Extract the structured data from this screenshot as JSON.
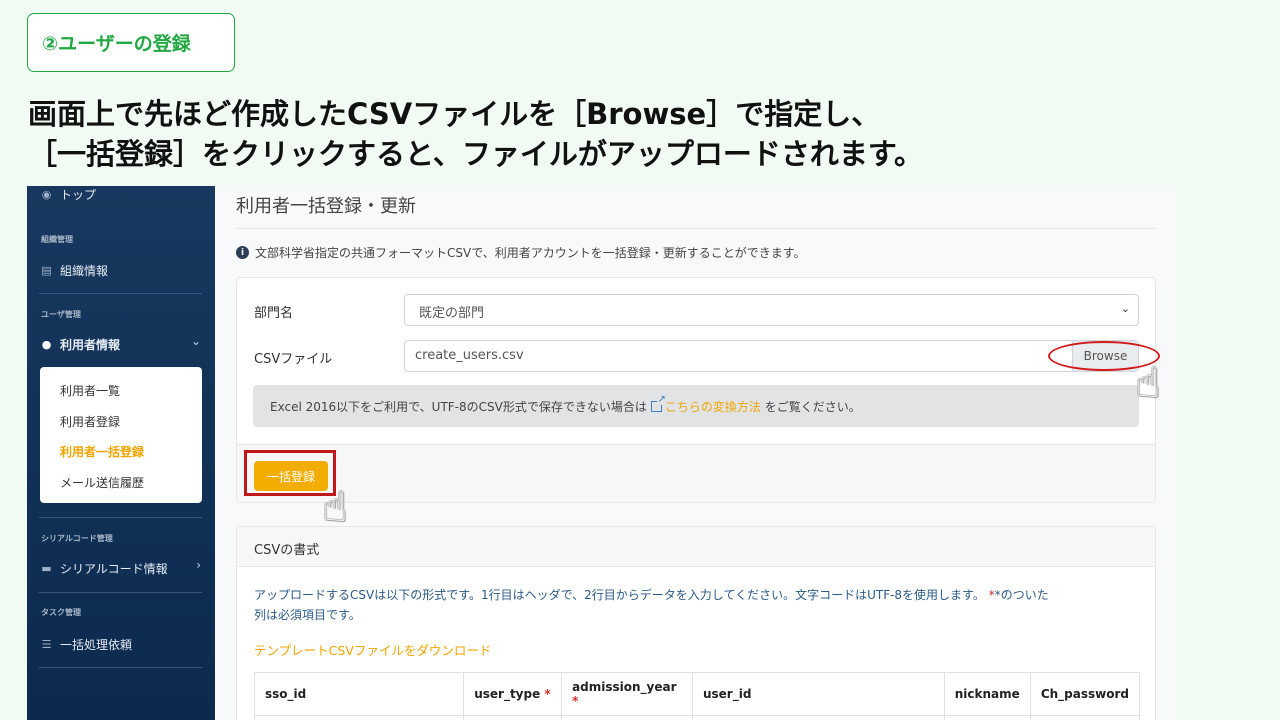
{
  "step_badge": "②ユーザーの登録",
  "headline": {
    "line1": "画面上で先ほど作成したCSVファイルを［Browse］で指定し、",
    "line2": "［一括登録］をクリックすると、ファイルがアップロードされます。"
  },
  "sidebar": {
    "top_item": "トップ",
    "sections": {
      "org": "組織管理",
      "user": "ユーザ管理",
      "serial": "シリアルコード管理",
      "task": "タスク管理"
    },
    "org_info": "組織情報",
    "user_info": "利用者情報",
    "submenu": [
      "利用者一覧",
      "利用者登録",
      "利用者一括登録",
      "メール送信履歴"
    ],
    "serial_info": "シリアルコード情報",
    "bulk_request": "一括処理依頼"
  },
  "main": {
    "title": "利用者一括登録・更新",
    "info": "文部科学省指定の共通フォーマットCSVで、利用者アカウントを一括登録・更新することができます。",
    "form": {
      "dept_label": "部門名",
      "dept_value": "既定の部門",
      "csv_label": "CSVファイル",
      "csv_value": "create_users.csv",
      "browse_label": "Browse",
      "alert_prefix": "Excel 2016以下をご利用で、UTF-8のCSV形式で保存できない場合は",
      "alert_link": "こちらの変換方法",
      "alert_suffix": "をご覧ください。",
      "submit_label": "一括登録"
    },
    "format": {
      "heading": "CSVの書式",
      "desc_line1": "アップロードするCSVは以下の形式です。1行目はヘッダで、2行目からデータを入力してください。文字コードはUTF-8を使用します。",
      "desc_req": "*のついた",
      "desc_line2": "列は必須項目です。",
      "template_link": "テンプレートCSVファイルをダウンロード",
      "columns": [
        "sso_id",
        "user_type",
        "admission_year",
        "user_id",
        "nickname",
        "Ch_password"
      ],
      "required_mark": "*"
    }
  },
  "colors": {
    "accent": "#f2ad00",
    "badge_green": "#22a743",
    "sidebar_bg": "#14345a",
    "highlight_red": "#c0191c"
  }
}
